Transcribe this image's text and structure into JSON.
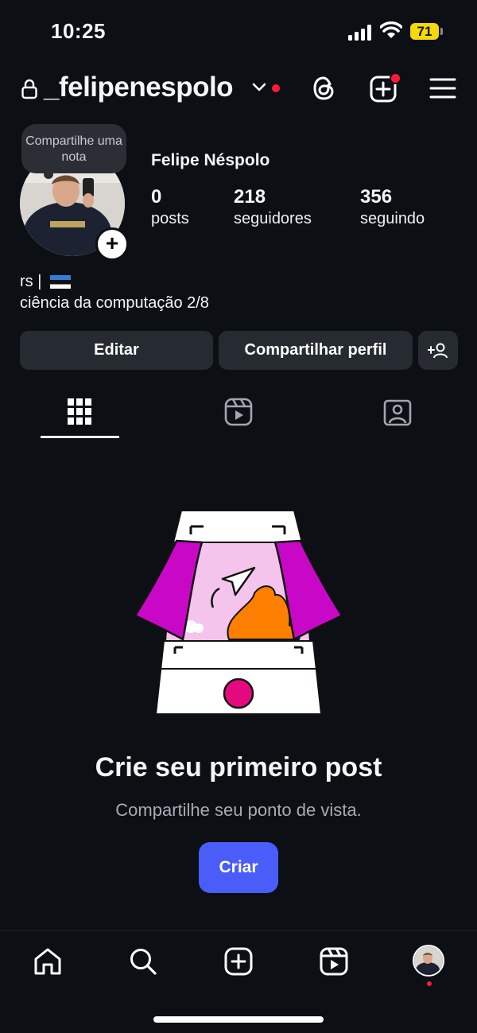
{
  "status_bar": {
    "time": "10:25",
    "battery_level": "71",
    "icons": [
      "cellular-signal-icon",
      "wifi-icon",
      "battery-icon"
    ]
  },
  "header": {
    "username": "_felipenespolo",
    "icons": [
      "lock-icon",
      "chevron-down-icon",
      "threads-icon",
      "create-post-icon",
      "menu-icon"
    ],
    "notification_color": "#ff1a3c"
  },
  "profile": {
    "note_text": "Compartilhe uma nota",
    "full_name": "Felipe Néspolo",
    "stats": [
      {
        "value": "0",
        "label": "posts"
      },
      {
        "value": "218",
        "label": "seguidores"
      },
      {
        "value": "356",
        "label": "seguindo"
      }
    ],
    "bio_line1": "rs |",
    "bio_line2": "ciência da computação 2/8"
  },
  "actions": {
    "edit_label": "Editar",
    "share_label": "Compartilhar perfil",
    "discover_icon": "add-person-icon"
  },
  "tabs": [
    {
      "name": "grid",
      "icon": "grid-icon",
      "active": true
    },
    {
      "name": "reels",
      "icon": "reels-icon",
      "active": false
    },
    {
      "name": "tagged",
      "icon": "tagged-icon",
      "active": false
    }
  ],
  "empty_state": {
    "title": "Crie seu primeiro post",
    "subtitle": "Compartilhe seu ponto de vista.",
    "button_label": "Criar",
    "button_color": "#4a5df9"
  },
  "bottom_nav": {
    "items": [
      "home-icon",
      "search-icon",
      "create-icon",
      "reels-icon",
      "profile-avatar"
    ]
  }
}
